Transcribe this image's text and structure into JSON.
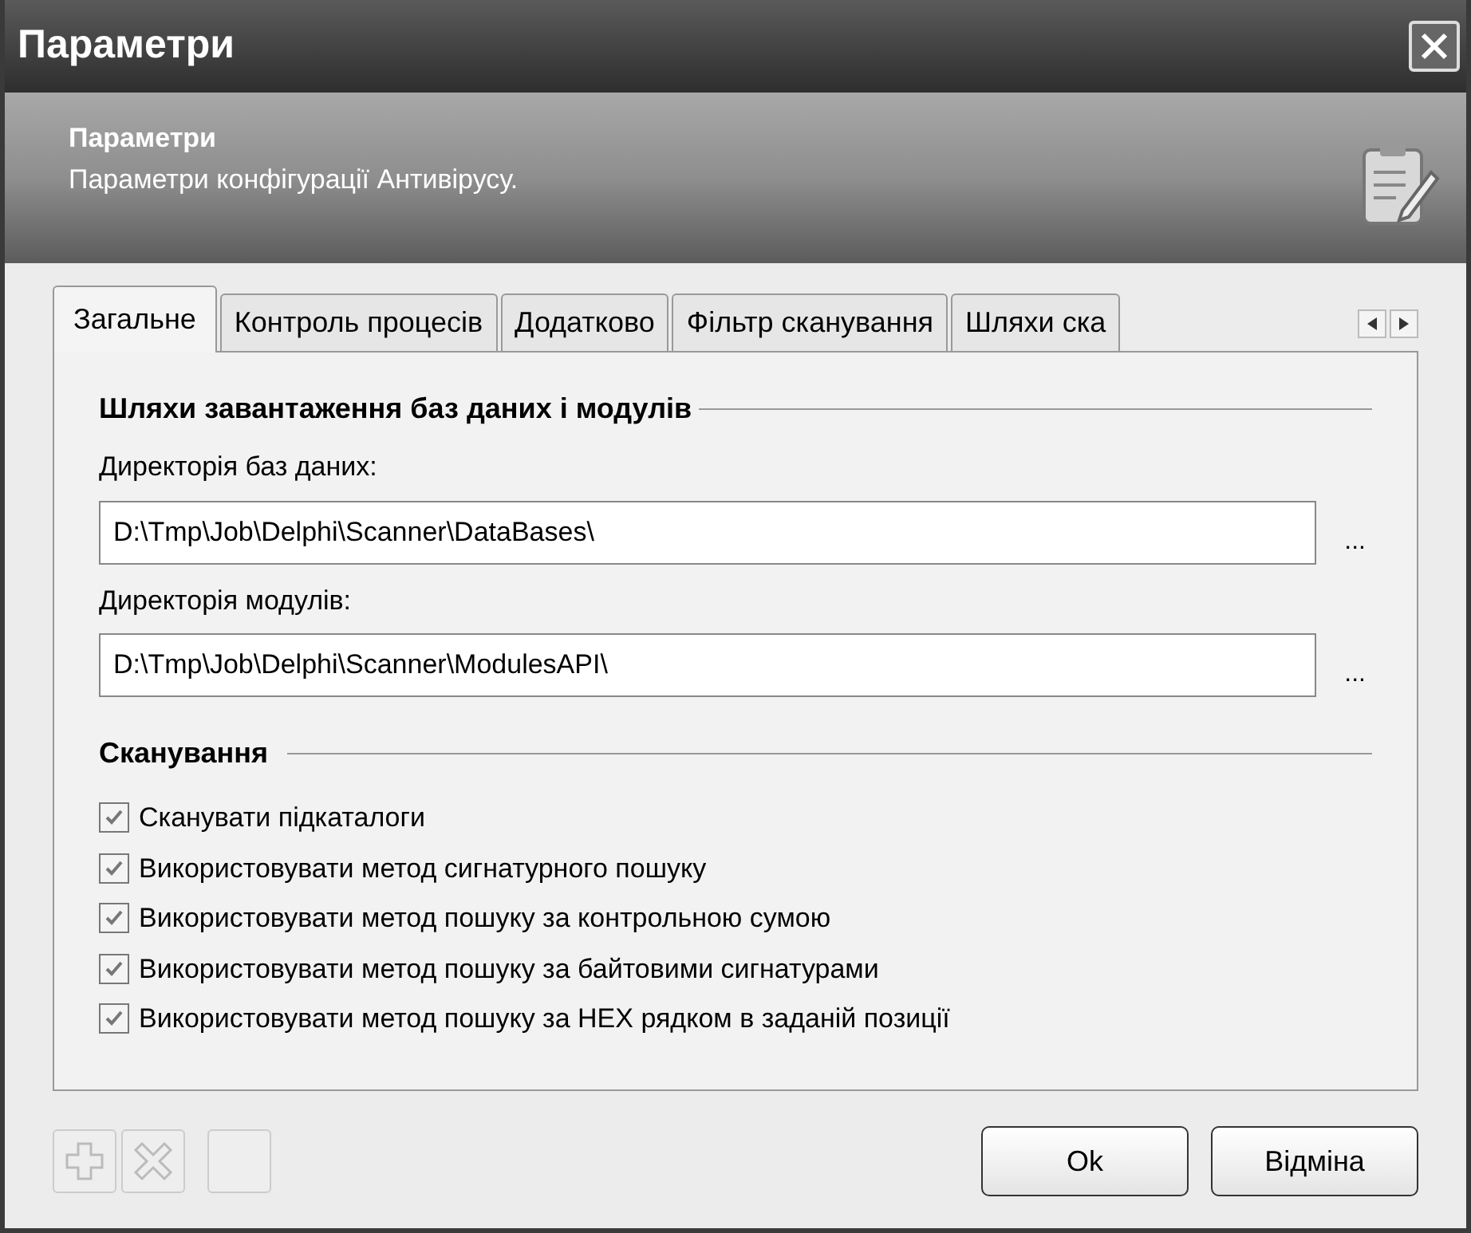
{
  "window": {
    "title": "Параметри"
  },
  "header": {
    "title": "Параметри",
    "subtitle": "Параметри конфігурації Антивірусу."
  },
  "tabs": [
    {
      "label": "Загальне",
      "selected": true
    },
    {
      "label": "Контроль процесів",
      "selected": false
    },
    {
      "label": "Додатково",
      "selected": false
    },
    {
      "label": "Фільтр сканування",
      "selected": false
    },
    {
      "label": "Шляхи ска",
      "selected": false
    }
  ],
  "paths_group": {
    "title": "Шляхи завантаження баз даних і модулів",
    "fields": [
      {
        "label": "Директорія баз даних:",
        "value": "D:\\Tmp\\Job\\Delphi\\Scanner\\DataBases\\",
        "browse": "..."
      },
      {
        "label": "Директорія модулів:",
        "value": "D:\\Tmp\\Job\\Delphi\\Scanner\\ModulesAPI\\",
        "browse": "..."
      }
    ]
  },
  "scan_group": {
    "title": "Сканування",
    "options": [
      {
        "label": "Сканувати підкаталоги",
        "checked": true
      },
      {
        "label": "Використовувати метод сигнатурного пошуку",
        "checked": true
      },
      {
        "label": "Використовувати метод пошуку за контрольною сумою",
        "checked": true
      },
      {
        "label": "Використовувати метод пошуку за байтовими сигнатурами",
        "checked": true
      },
      {
        "label": "Використовувати метод пошуку за HEX рядком в заданій позиції",
        "checked": true
      }
    ]
  },
  "buttons": [
    {
      "label": "Ok"
    },
    {
      "label": "Відміна"
    }
  ]
}
